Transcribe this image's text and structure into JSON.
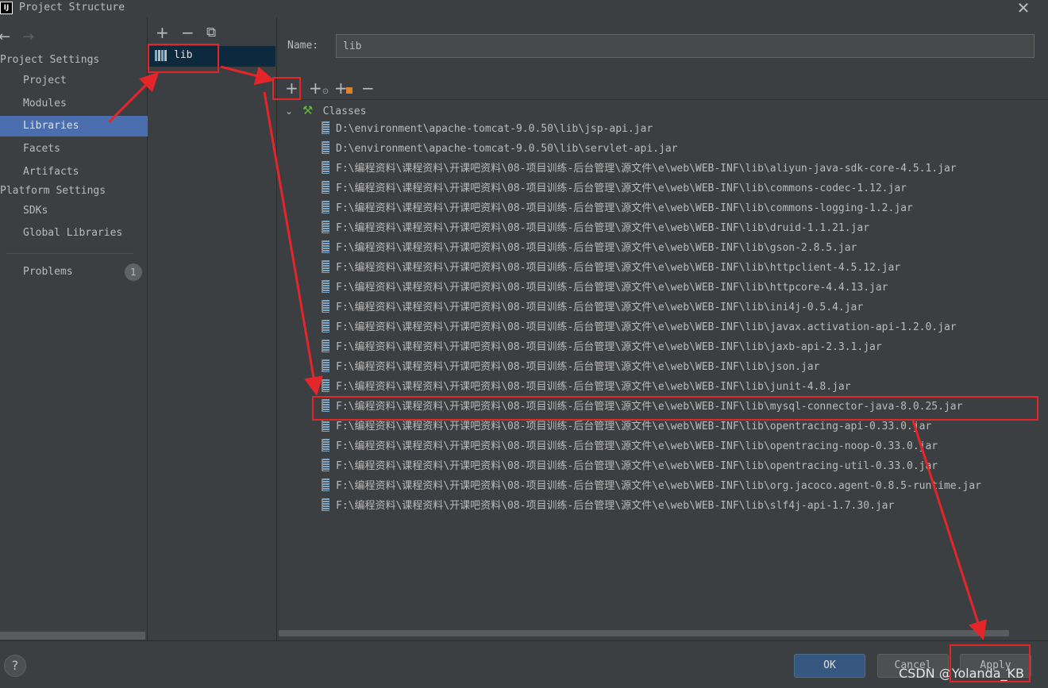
{
  "window": {
    "title": "Project Structure",
    "app_icon": "IJ"
  },
  "nav": {
    "sections": [
      {
        "label": "Project Settings"
      },
      {
        "label": "Platform Settings"
      }
    ],
    "items": [
      {
        "label": "Project"
      },
      {
        "label": "Modules"
      },
      {
        "label": "Libraries"
      },
      {
        "label": "Facets"
      },
      {
        "label": "Artifacts"
      },
      {
        "label": "SDKs"
      },
      {
        "label": "Global Libraries"
      },
      {
        "label": "Problems",
        "badge": "1"
      }
    ],
    "selected": "Libraries"
  },
  "libraries": {
    "items": [
      {
        "label": "lib"
      }
    ]
  },
  "detail": {
    "name_label": "Name:",
    "name_value": "lib",
    "classes_label": "Classes",
    "jars": [
      "D:\\environment\\apache-tomcat-9.0.50\\lib\\jsp-api.jar",
      "D:\\environment\\apache-tomcat-9.0.50\\lib\\servlet-api.jar",
      "F:\\编程资料\\课程资料\\开课吧资料\\08-项目训练-后台管理\\源文件\\e\\web\\WEB-INF\\lib\\aliyun-java-sdk-core-4.5.1.jar",
      "F:\\编程资料\\课程资料\\开课吧资料\\08-项目训练-后台管理\\源文件\\e\\web\\WEB-INF\\lib\\commons-codec-1.12.jar",
      "F:\\编程资料\\课程资料\\开课吧资料\\08-项目训练-后台管理\\源文件\\e\\web\\WEB-INF\\lib\\commons-logging-1.2.jar",
      "F:\\编程资料\\课程资料\\开课吧资料\\08-项目训练-后台管理\\源文件\\e\\web\\WEB-INF\\lib\\druid-1.1.21.jar",
      "F:\\编程资料\\课程资料\\开课吧资料\\08-项目训练-后台管理\\源文件\\e\\web\\WEB-INF\\lib\\gson-2.8.5.jar",
      "F:\\编程资料\\课程资料\\开课吧资料\\08-项目训练-后台管理\\源文件\\e\\web\\WEB-INF\\lib\\httpclient-4.5.12.jar",
      "F:\\编程资料\\课程资料\\开课吧资料\\08-项目训练-后台管理\\源文件\\e\\web\\WEB-INF\\lib\\httpcore-4.4.13.jar",
      "F:\\编程资料\\课程资料\\开课吧资料\\08-项目训练-后台管理\\源文件\\e\\web\\WEB-INF\\lib\\ini4j-0.5.4.jar",
      "F:\\编程资料\\课程资料\\开课吧资料\\08-项目训练-后台管理\\源文件\\e\\web\\WEB-INF\\lib\\javax.activation-api-1.2.0.jar",
      "F:\\编程资料\\课程资料\\开课吧资料\\08-项目训练-后台管理\\源文件\\e\\web\\WEB-INF\\lib\\jaxb-api-2.3.1.jar",
      "F:\\编程资料\\课程资料\\开课吧资料\\08-项目训练-后台管理\\源文件\\e\\web\\WEB-INF\\lib\\json.jar",
      "F:\\编程资料\\课程资料\\开课吧资料\\08-项目训练-后台管理\\源文件\\e\\web\\WEB-INF\\lib\\junit-4.8.jar",
      "F:\\编程资料\\课程资料\\开课吧资料\\08-项目训练-后台管理\\源文件\\e\\web\\WEB-INF\\lib\\mysql-connector-java-8.0.25.jar",
      "F:\\编程资料\\课程资料\\开课吧资料\\08-项目训练-后台管理\\源文件\\e\\web\\WEB-INF\\lib\\opentracing-api-0.33.0.jar",
      "F:\\编程资料\\课程资料\\开课吧资料\\08-项目训练-后台管理\\源文件\\e\\web\\WEB-INF\\lib\\opentracing-noop-0.33.0.jar",
      "F:\\编程资料\\课程资料\\开课吧资料\\08-项目训练-后台管理\\源文件\\e\\web\\WEB-INF\\lib\\opentracing-util-0.33.0.jar",
      "F:\\编程资料\\课程资料\\开课吧资料\\08-项目训练-后台管理\\源文件\\e\\web\\WEB-INF\\lib\\org.jacoco.agent-0.8.5-runtime.jar",
      "F:\\编程资料\\课程资料\\开课吧资料\\08-项目训练-后台管理\\源文件\\e\\web\\WEB-INF\\lib\\slf4j-api-1.7.30.jar"
    ],
    "highlighted_jar": "mysql-connector-java-8.0.25.jar"
  },
  "buttons": {
    "ok": "OK",
    "cancel": "Cancel",
    "apply": "Apply",
    "help": "?"
  },
  "watermark": "CSDN @Yolanda_KB",
  "colors": {
    "selection": "#4b6eaf",
    "annotation": "#e4262b",
    "ok_button": "#365880",
    "background": "#3c3f41"
  }
}
